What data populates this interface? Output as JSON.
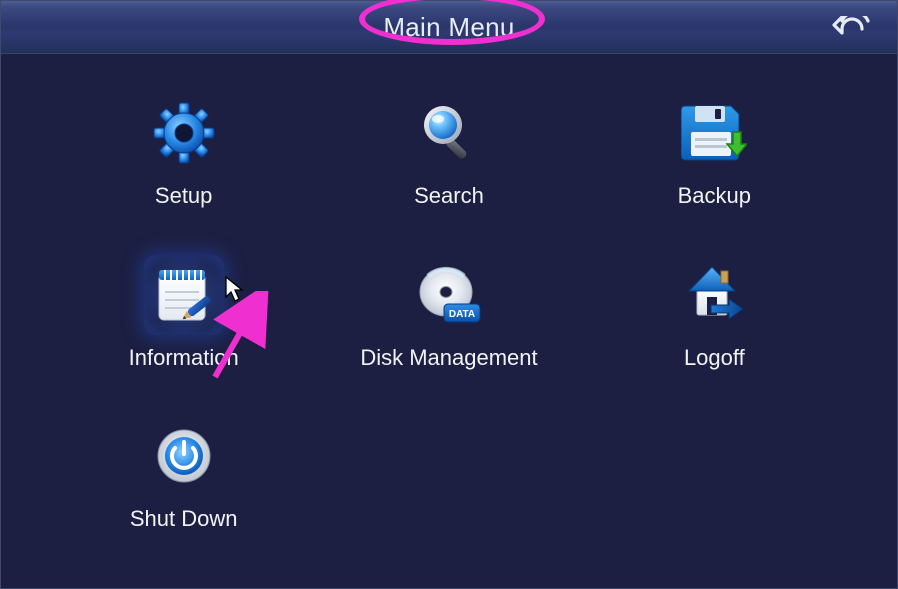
{
  "title": "Main Menu",
  "items": [
    {
      "label": "Setup"
    },
    {
      "label": "Search"
    },
    {
      "label": "Backup"
    },
    {
      "label": "Information"
    },
    {
      "label": "Disk Management"
    },
    {
      "label": "Logoff"
    },
    {
      "label": "Shut Down"
    }
  ]
}
